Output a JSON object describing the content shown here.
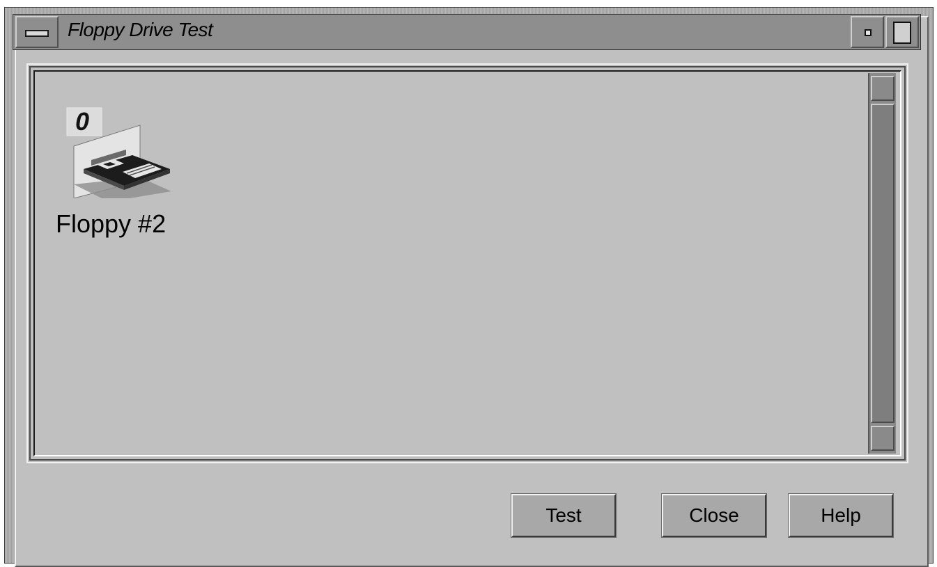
{
  "window": {
    "title": "Floppy Drive Test"
  },
  "items": [
    {
      "label": "Floppy #2",
      "icon": "floppy-drive-icon",
      "badge": "0"
    }
  ],
  "buttons": {
    "test": "Test",
    "close": "Close",
    "help": "Help"
  }
}
